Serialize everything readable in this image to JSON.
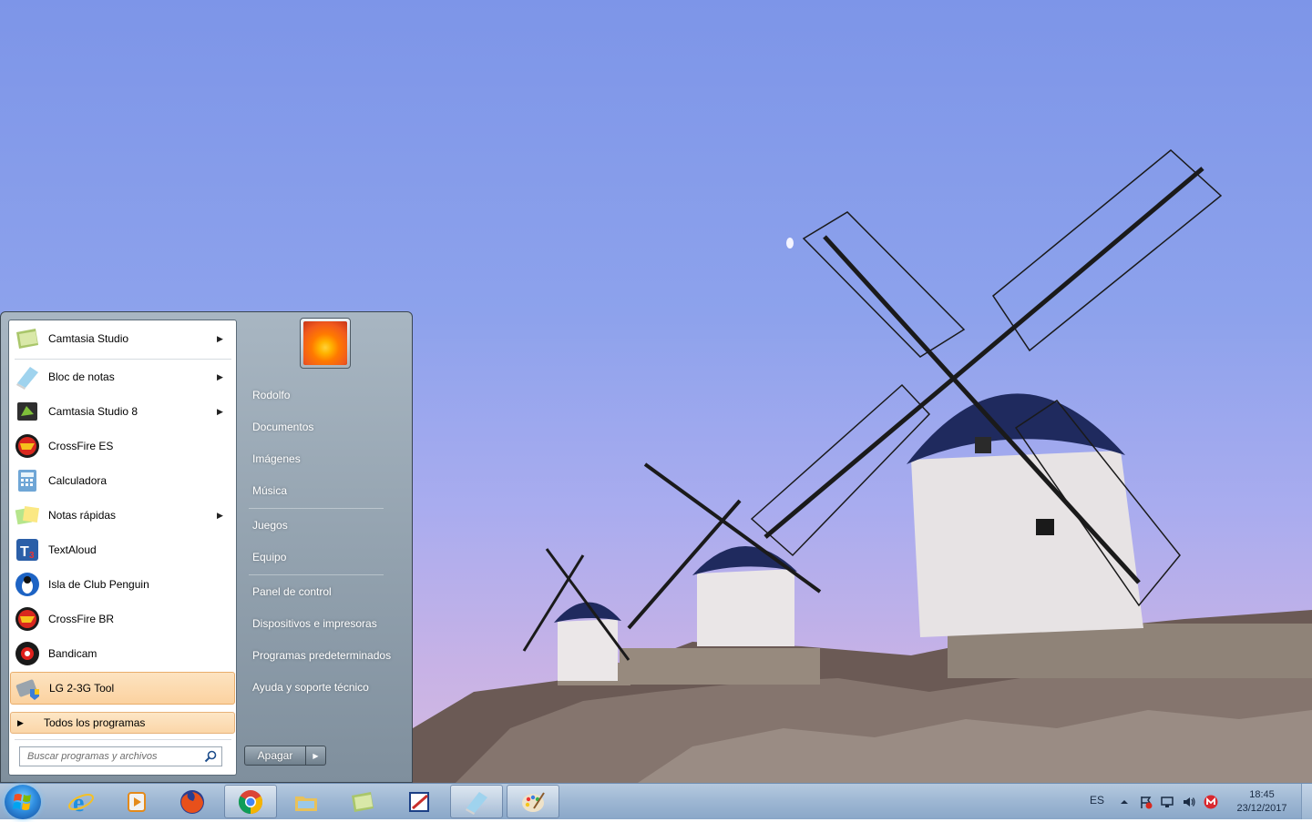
{
  "start_menu": {
    "programs": [
      {
        "label": "Camtasia Studio",
        "icon": "camtasia-studio-icon",
        "submenu": true
      },
      {
        "label": "Bloc de notas",
        "icon": "notepad-icon",
        "submenu": true
      },
      {
        "label": "Camtasia Studio 8",
        "icon": "camtasia-studio-8-icon",
        "submenu": true
      },
      {
        "label": "CrossFire ES",
        "icon": "crossfire-es-icon",
        "submenu": false
      },
      {
        "label": "Calculadora",
        "icon": "calculator-icon",
        "submenu": false
      },
      {
        "label": "Notas rápidas",
        "icon": "sticky-notes-icon",
        "submenu": true
      },
      {
        "label": "TextAloud",
        "icon": "textaloud-icon",
        "submenu": false
      },
      {
        "label": "Isla de Club Penguin",
        "icon": "club-penguin-icon",
        "submenu": false
      },
      {
        "label": "CrossFire BR",
        "icon": "crossfire-br-icon",
        "submenu": false
      },
      {
        "label": "Bandicam",
        "icon": "bandicam-icon",
        "submenu": false
      },
      {
        "label": "LG 2-3G Tool",
        "icon": "lg-tool-icon",
        "submenu": false,
        "selected": true
      }
    ],
    "all_programs": "Todos los programas",
    "search_placeholder": "Buscar programas y archivos",
    "right_items": [
      "Rodolfo",
      "Documentos",
      "Imágenes",
      "Música",
      "Juegos",
      "Equipo",
      "Panel de control",
      "Dispositivos e impresoras",
      "Programas predeterminados",
      "Ayuda y soporte técnico"
    ],
    "shutdown_label": "Apagar"
  },
  "taskbar": {
    "pinned": [
      {
        "name": "internet-explorer",
        "open": false
      },
      {
        "name": "media-player",
        "open": false
      },
      {
        "name": "firefox",
        "open": false
      },
      {
        "name": "chrome",
        "open": true
      },
      {
        "name": "file-explorer",
        "open": false
      },
      {
        "name": "camtasia",
        "open": false
      },
      {
        "name": "paint-app",
        "open": false
      },
      {
        "name": "notepad",
        "open": true
      },
      {
        "name": "paint",
        "open": true
      }
    ],
    "tray": {
      "language": "ES",
      "time": "18:45",
      "date": "23/12/2017"
    }
  }
}
